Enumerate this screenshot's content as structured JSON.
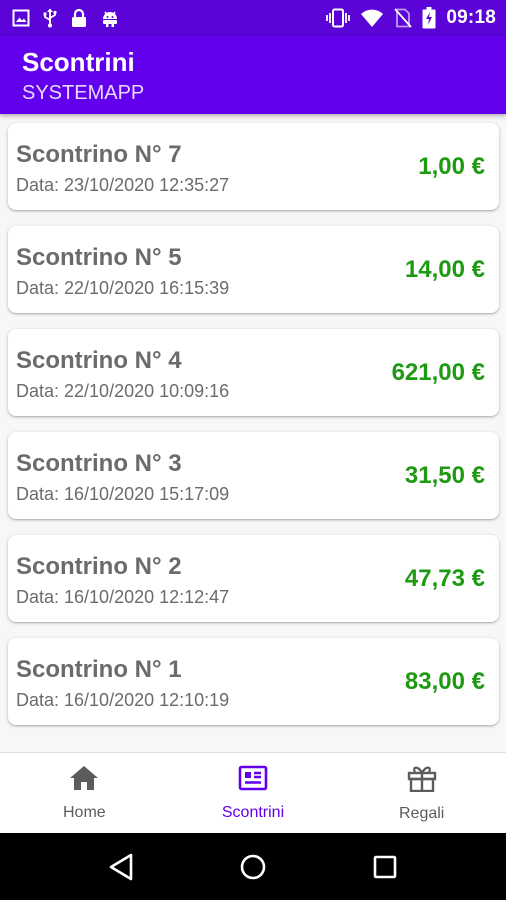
{
  "status_bar": {
    "time": "09:18",
    "icons_left": [
      "image-icon",
      "usb-icon",
      "lock-icon",
      "android-icon"
    ],
    "icons_right": [
      "vibrate-icon",
      "wifi-icon",
      "no-sim-icon",
      "battery-charging-icon"
    ]
  },
  "app_bar": {
    "title": "Scontrini",
    "subtitle": "SYSTEMAPP",
    "color": "#6200ee"
  },
  "receipts": [
    {
      "title": "Scontrino N° 7",
      "date": "Data: 23/10/2020 12:35:27",
      "amount": "1,00 €"
    },
    {
      "title": "Scontrino N° 5",
      "date": "Data: 22/10/2020 16:15:39",
      "amount": "14,00 €"
    },
    {
      "title": "Scontrino N° 4",
      "date": "Data: 22/10/2020 10:09:16",
      "amount": "621,00 €"
    },
    {
      "title": "Scontrino N° 3",
      "date": "Data: 16/10/2020 15:17:09",
      "amount": "31,50 €"
    },
    {
      "title": "Scontrino N° 2",
      "date": "Data: 16/10/2020 12:12:47",
      "amount": "47,73 €"
    },
    {
      "title": "Scontrino N° 1",
      "date": "Data: 16/10/2020 12:10:19",
      "amount": "83,00 €"
    }
  ],
  "amount_color": "#1d9a12",
  "bottom_nav": [
    {
      "label": "Home",
      "icon": "home-icon",
      "active": false
    },
    {
      "label": "Scontrini",
      "icon": "receipt-icon",
      "active": true
    },
    {
      "label": "Regali",
      "icon": "gift-icon",
      "active": false
    }
  ],
  "system_nav": [
    "back-icon",
    "home-circle-icon",
    "recents-icon"
  ]
}
